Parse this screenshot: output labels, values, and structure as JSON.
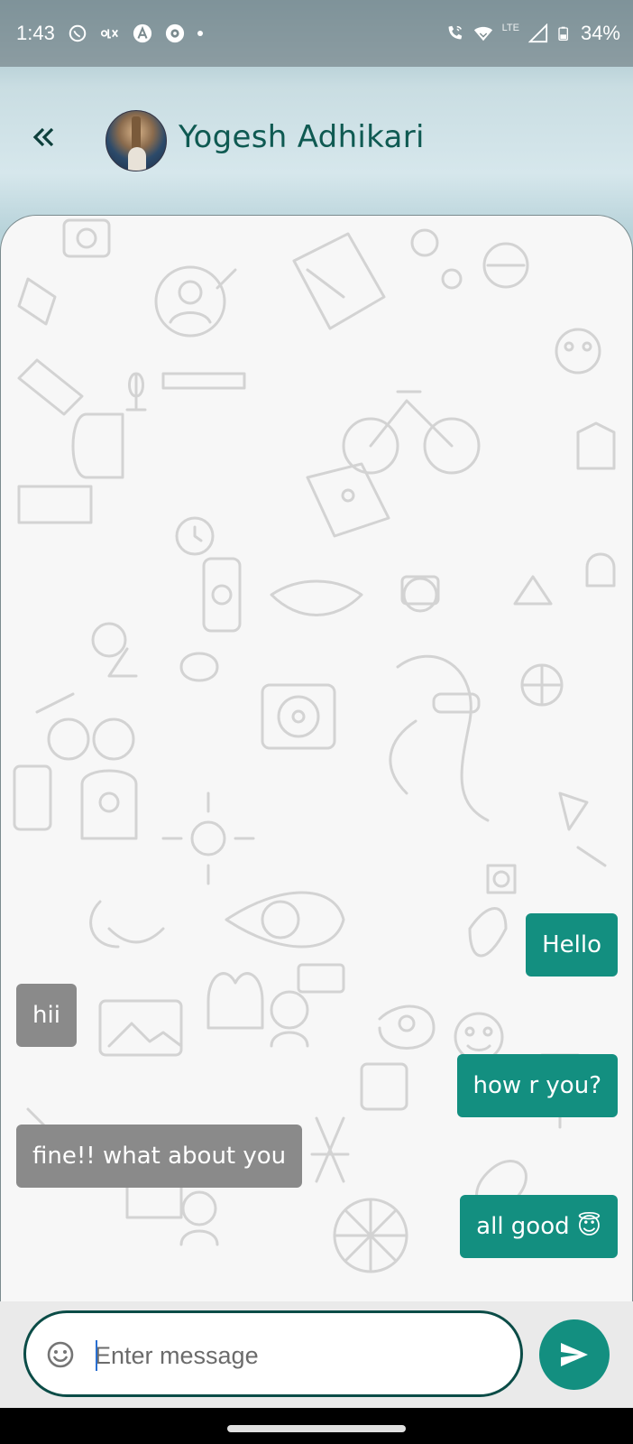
{
  "status_bar": {
    "time": "1:43",
    "network": "LTE",
    "battery": "34%",
    "left_icons": [
      "whatsapp-icon",
      "olx-icon",
      "a-icon",
      "camera-icon",
      "dot"
    ],
    "right_icons": [
      "wifi-call-icon",
      "wifi-icon",
      "signal-icon",
      "battery-icon"
    ]
  },
  "header": {
    "contact_name": "Yogesh Adhikari",
    "back_icon": "double-chevron-left-icon"
  },
  "messages": [
    {
      "side": "sent",
      "text": "Hello"
    },
    {
      "side": "received",
      "text": "hii"
    },
    {
      "side": "sent",
      "text": "how r you?"
    },
    {
      "side": "received",
      "text": "fine!! what about you"
    },
    {
      "side": "sent",
      "text": "all good 😇"
    }
  ],
  "composer": {
    "placeholder": "Enter message",
    "emoji_icon": "emoji-icon",
    "send_icon": "send-icon"
  },
  "colors": {
    "accent": "#138f80",
    "header_text": "#0f5a52",
    "received_bubble": "#8a8a8a",
    "input_border": "#0b4c47"
  }
}
